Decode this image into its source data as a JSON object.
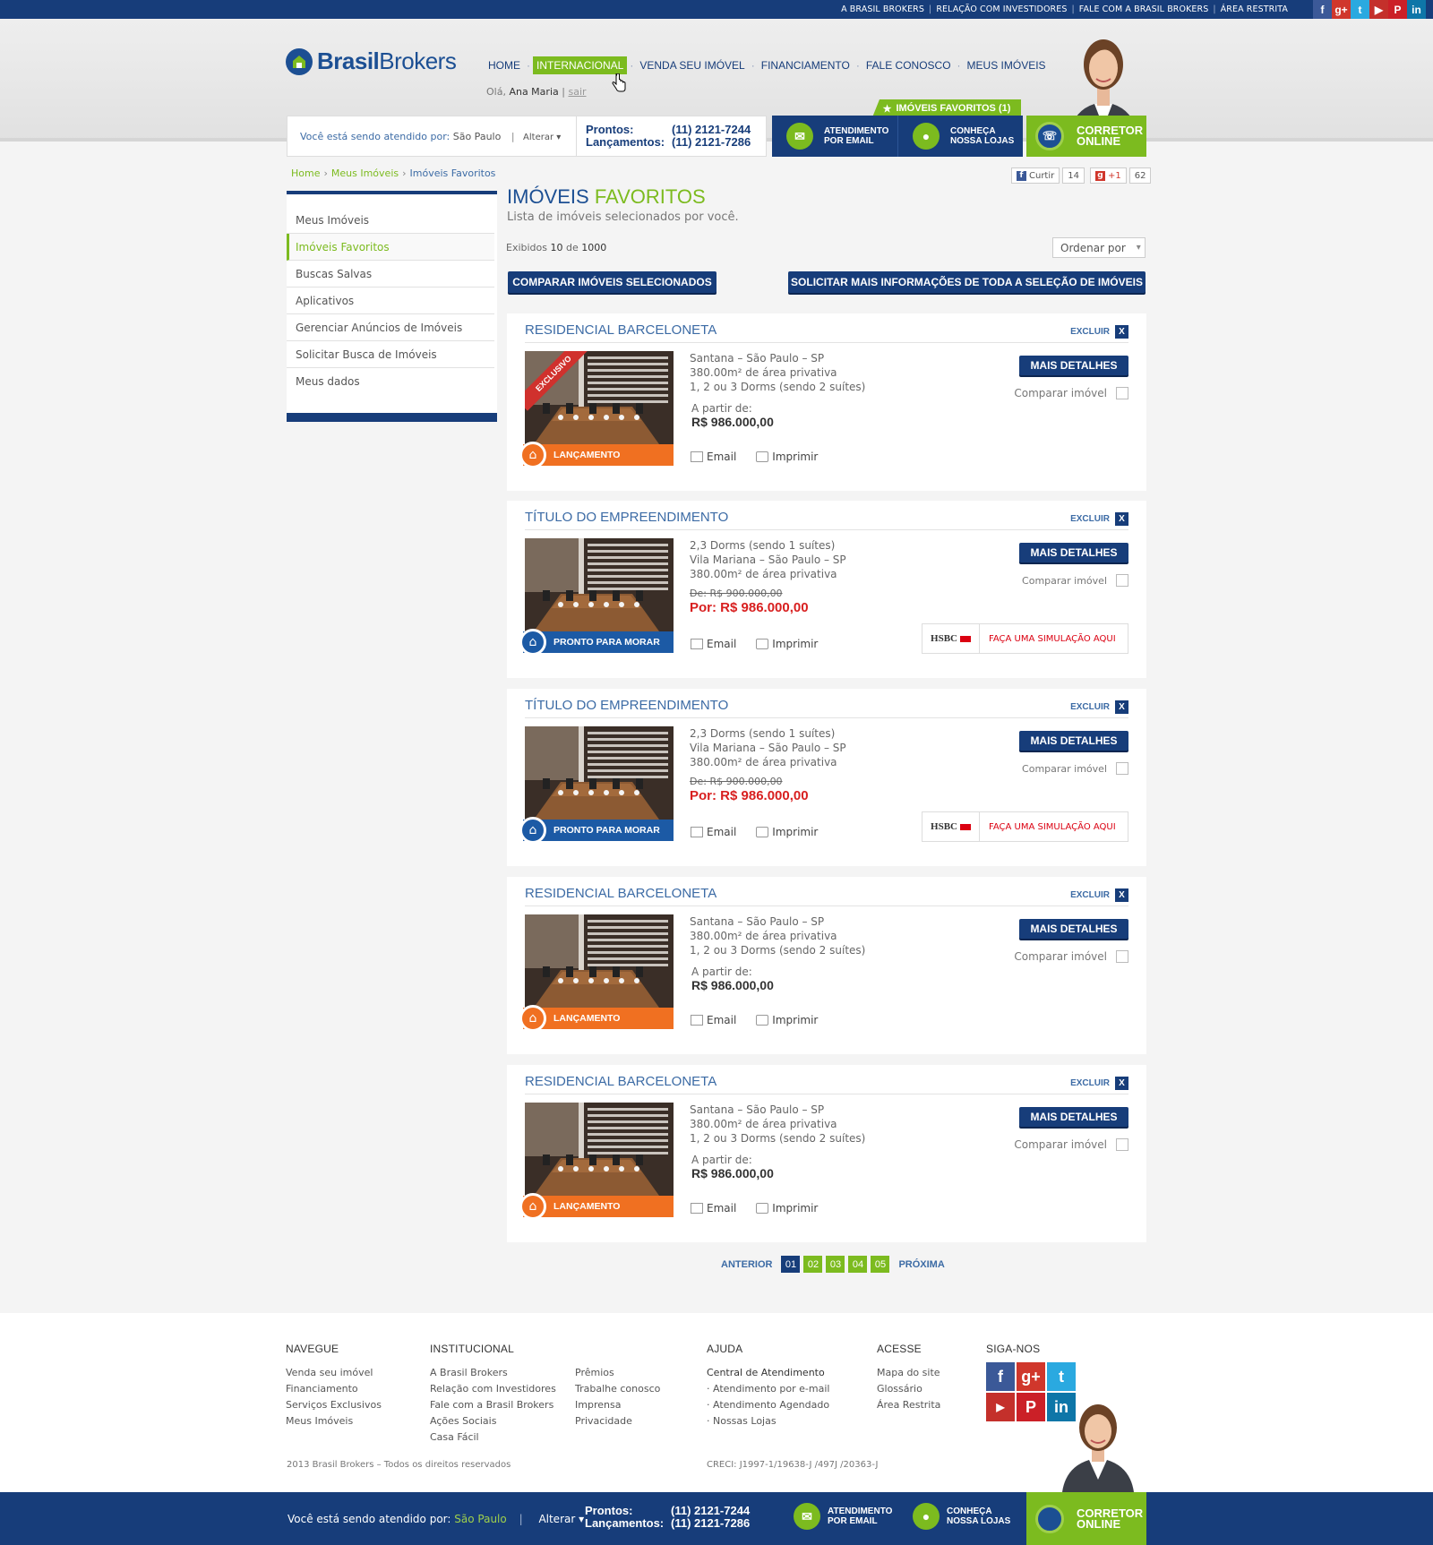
{
  "top": {
    "links": [
      "A BRASIL BROKERS",
      "RELAÇÃO COM INVESTIDORES",
      "FALE COM A BRASIL BROKERS",
      "ÁREA RESTRITA"
    ],
    "social": [
      "facebook-icon",
      "google-plus-icon",
      "twitter-icon",
      "youtube-icon",
      "pinterest-icon",
      "linkedin-icon"
    ]
  },
  "brand": {
    "name_bold": "Brasil",
    "name_light": "Brokers",
    "blue": "#173d7a",
    "green": "#7cbb1f",
    "orange": "#f07021",
    "red": "#d81f1f"
  },
  "nav": {
    "items": [
      "HOME",
      "INTERNACIONAL",
      "VENDA SEU IMÓVEL",
      "FINANCIAMENTO",
      "FALE CONOSCO",
      "MEUS IMÓVEIS"
    ],
    "active": "INTERNACIONAL",
    "greet_prefix": "Olá,",
    "user": "Ana Maria",
    "sep": "|",
    "logout": "sair"
  },
  "favorites_tab": "IMÓVEIS FAVORITOS (1)",
  "location": {
    "label": "Você está sendo atendido por:",
    "city": "São Paulo",
    "change": "Alterar"
  },
  "phones": {
    "prontos_label": "Prontos:",
    "prontos": "(11) 2121-7244",
    "lanc_label": "Lançamentos:",
    "lanc": "(11) 2121-7286"
  },
  "cta": {
    "email_line1": "ATENDIMENTO",
    "email_line2": "POR EMAIL",
    "lojas_line1": "CONHEÇA",
    "lojas_line2": "NOSSA LOJAS",
    "corretor_line1": "CORRETOR",
    "corretor_line2": "ONLINE"
  },
  "breadcrumb": [
    "Home",
    "Meus Imóveis",
    "Imóveis Favoritos"
  ],
  "share": {
    "like": "Curtir",
    "like_count": "14",
    "plus": "+1",
    "plus_count": "62"
  },
  "sidebar": {
    "items": [
      "Meus Imóveis",
      "Imóveis Favoritos",
      "Buscas Salvas",
      "Aplicativos",
      "Gerenciar Anúncios de Imóveis",
      "Solicitar Busca de Imóveis",
      "Meus dados"
    ],
    "active": "Imóveis Favoritos"
  },
  "page": {
    "title_blue": "IMÓVEIS",
    "title_green": "FAVORITOS",
    "subtitle": "Lista de imóveis selecionados por você.",
    "count_prefix": "Exibidos",
    "count_shown": "10",
    "count_mid": "de",
    "count_total": "1000",
    "order": "Ordenar por",
    "compare_btn": "COMPARAR IMÓVEIS SELECIONADOS",
    "request_btn": "SOLICITAR MAIS INFORMAÇÕES DE TODA A SELEÇÃO DE IMÓVEIS"
  },
  "listings": [
    {
      "title": "RESIDENCIAL BARCELONETA",
      "badge": "LANÇAMENTO",
      "type": "launch",
      "ribbon": "EXCLUSIVO",
      "info": [
        "Santana – São Paulo – SP",
        "380.00m² de área privativa",
        "1, 2 ou 3 Dorms (sendo 2 suítes)"
      ],
      "price_label": "A partir de:",
      "price": "R$ 986.000,00"
    },
    {
      "title": "TÍTULO DO EMPREENDIMENTO",
      "badge": "PRONTO PARA MORAR",
      "type": "ready",
      "info": [
        "2,3 Dorms (sendo 1 suítes)",
        "Vila Mariana – São Paulo – SP",
        "380.00m² de área privativa"
      ],
      "old_price": "De: R$ 900.000,00",
      "new_price": "Por: R$ 986.000,00"
    },
    {
      "title": "TÍTULO DO EMPREENDIMENTO",
      "badge": "PRONTO PARA MORAR",
      "type": "ready",
      "info": [
        "2,3 Dorms (sendo 1 suítes)",
        "Vila Mariana – São Paulo – SP",
        "380.00m² de área privativa"
      ],
      "old_price": "De: R$ 900.000,00",
      "new_price": "Por: R$ 986.000,00"
    },
    {
      "title": "RESIDENCIAL BARCELONETA",
      "badge": "LANÇAMENTO",
      "type": "launch",
      "info": [
        "Santana – São Paulo – SP",
        "380.00m² de área privativa",
        "1, 2 ou 3 Dorms (sendo 2 suítes)"
      ],
      "price_label": "A partir de:",
      "price": "R$ 986.000,00"
    },
    {
      "title": "RESIDENCIAL BARCELONETA",
      "badge": "LANÇAMENTO",
      "type": "launch",
      "info": [
        "Santana – São Paulo – SP",
        "380.00m² de área privativa",
        "1, 2 ou 3 Dorms (sendo 2 suítes)"
      ],
      "price_label": "A partir de:",
      "price": "R$ 986.000,00"
    }
  ],
  "card_labels": {
    "excluir": "EXCLUIR",
    "x": "X",
    "email": "Email",
    "print": "Imprimir",
    "details": "MAIS DETALHES",
    "compare": "Comparar imóvel",
    "hsbc": "HSBC",
    "simulate_prefix": "FAÇA UMA ",
    "simulate_strong": "SIMULAÇÃO AQUI"
  },
  "pager": {
    "prev": "ANTERIOR",
    "pages": [
      "01",
      "02",
      "03",
      "04",
      "05"
    ],
    "current": "01",
    "next": "PRÓXIMA"
  },
  "footer": {
    "navegue": {
      "title": "NAVEGUE",
      "items": [
        "Venda seu imóvel",
        "Financiamento",
        "Serviços Exclusivos",
        "Meus Imóveis"
      ]
    },
    "institucional": {
      "title": "INSTITUCIONAL",
      "col1": [
        "A Brasil Brokers",
        "Relação com Investidores",
        "Fale com a Brasil Brokers",
        "Ações Sociais",
        "Casa Fácil"
      ],
      "col2": [
        "Prêmios",
        "Trabalhe conosco",
        "Imprensa",
        "Privacidade"
      ]
    },
    "ajuda": {
      "title": "AJUDA",
      "head": "Central de Atendimento",
      "items": [
        "· Atendimento por e-mail",
        "· Atendimento Agendado",
        "· Nossas Lojas"
      ]
    },
    "acesse": {
      "title": "ACESSE",
      "items": [
        "Mapa do site",
        "Glossário",
        "Área Restrita"
      ]
    },
    "siga": {
      "title": "SIGA-NOS"
    },
    "copyright": "2013 Brasil Brokers – Todos os direitos reservados",
    "creci": "CRECI: J1997-1/19638-J /497J /20363-J"
  }
}
